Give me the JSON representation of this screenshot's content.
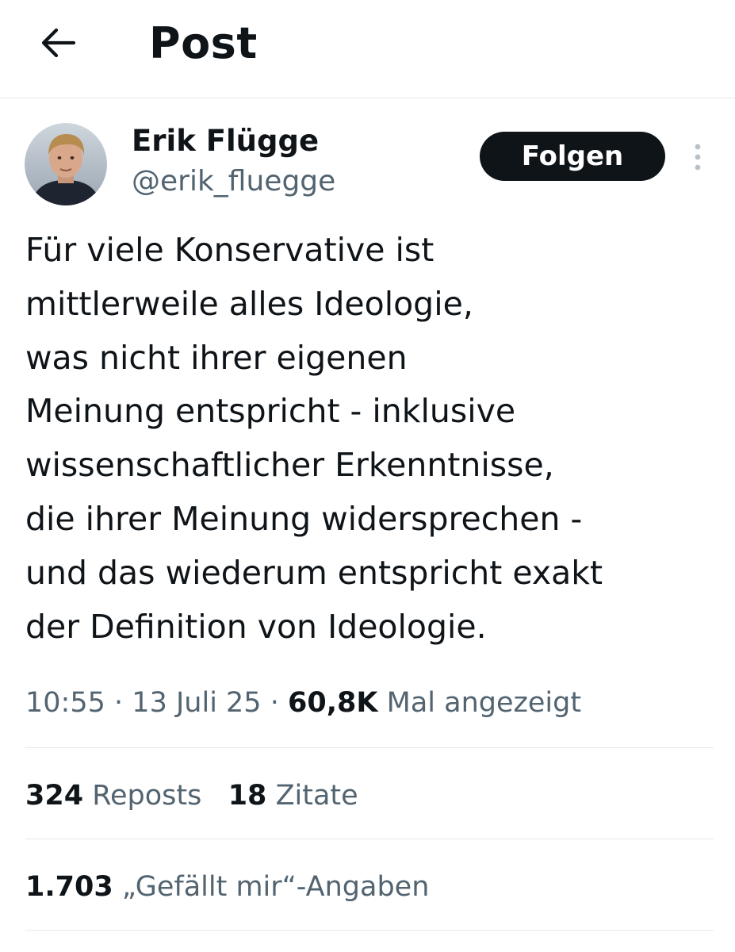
{
  "header": {
    "back_icon": "arrow-left-icon",
    "title": "Post"
  },
  "author": {
    "display_name": "Erik Flügge",
    "handle": "@erik_fluegge",
    "follow_label": "Folgen",
    "more_icon": "more-vertical-icon"
  },
  "tweet": {
    "lines": [
      "Für viele Konservative ist",
      "mittlerweile alles Ideologie,",
      "was nicht ihrer eigenen",
      "Meinung entspricht - inklusive",
      "wissenschaftlicher Erkenntnisse,",
      "die ihrer Meinung widersprechen -",
      "und das wiederum entspricht exakt",
      "der Definition von Ideologie."
    ]
  },
  "meta": {
    "time": "10:55",
    "date": "13 Juli 25",
    "separator": "·",
    "views_count": "60,8K",
    "views_label": "Mal angezeigt"
  },
  "stats": {
    "reposts_count": "324",
    "reposts_label": "Reposts",
    "quotes_count": "18",
    "quotes_label": "Zitate",
    "likes_count": "1.703",
    "likes_label": "„Gefällt mir“-Angaben"
  },
  "colors": {
    "text": "#0f1419",
    "secondary": "#536471",
    "divider": "#e6e9eb",
    "button_bg": "#0f1419",
    "button_text": "#ffffff"
  }
}
